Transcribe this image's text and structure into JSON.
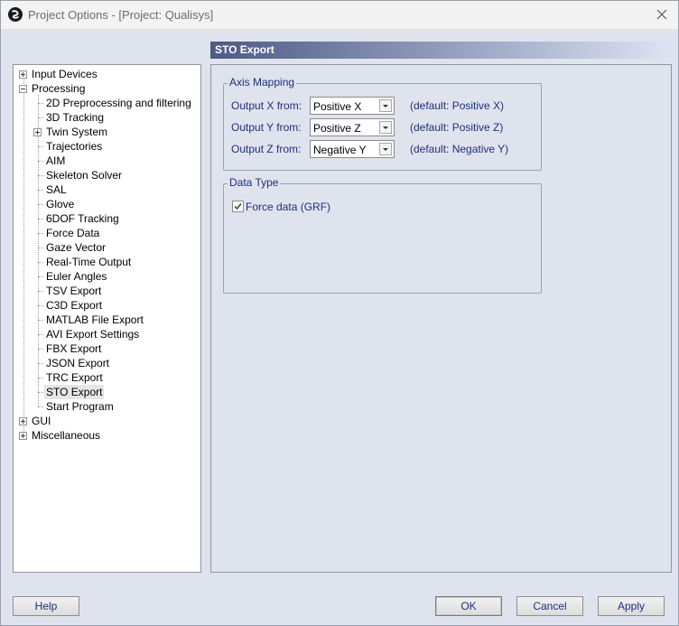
{
  "window": {
    "title": "Project Options - [Project: Qualisys]"
  },
  "tree": {
    "items": [
      {
        "label": "Input Devices",
        "expandable": true,
        "expanded": false,
        "level": 0
      },
      {
        "label": "Processing",
        "expandable": true,
        "expanded": true,
        "level": 0
      },
      {
        "label": "2D Preprocessing and filtering",
        "level": 1
      },
      {
        "label": "3D Tracking",
        "level": 1
      },
      {
        "label": "Twin System",
        "expandable": true,
        "expanded": false,
        "level": 1
      },
      {
        "label": "Trajectories",
        "level": 1
      },
      {
        "label": "AIM",
        "level": 1
      },
      {
        "label": "Skeleton Solver",
        "level": 1
      },
      {
        "label": "SAL",
        "level": 1
      },
      {
        "label": "Glove",
        "level": 1
      },
      {
        "label": "6DOF Tracking",
        "level": 1
      },
      {
        "label": "Force Data",
        "level": 1
      },
      {
        "label": "Gaze Vector",
        "level": 1
      },
      {
        "label": "Real-Time Output",
        "level": 1
      },
      {
        "label": "Euler Angles",
        "level": 1
      },
      {
        "label": "TSV Export",
        "level": 1
      },
      {
        "label": "C3D Export",
        "level": 1
      },
      {
        "label": "MATLAB File Export",
        "level": 1
      },
      {
        "label": "AVI Export Settings",
        "level": 1
      },
      {
        "label": "FBX Export",
        "level": 1
      },
      {
        "label": "JSON Export",
        "level": 1
      },
      {
        "label": "TRC Export",
        "level": 1
      },
      {
        "label": "STO Export",
        "level": 1,
        "selected": true
      },
      {
        "label": "Start Program",
        "level": 1
      },
      {
        "label": "GUI",
        "expandable": true,
        "expanded": false,
        "level": 0
      },
      {
        "label": "Miscellaneous",
        "expandable": true,
        "expanded": false,
        "level": 0
      }
    ]
  },
  "pane": {
    "title": "STO Export",
    "axis_mapping": {
      "title": "Axis Mapping",
      "rows": [
        {
          "label": "Output X from:",
          "value": "Positive X",
          "default": "(default: Positive X)"
        },
        {
          "label": "Output Y from:",
          "value": "Positive Z",
          "default": "(default: Positive Z)"
        },
        {
          "label": "Output Z from:",
          "value": "Negative Y",
          "default": "(default: Negative Y)"
        }
      ]
    },
    "data_type": {
      "title": "Data Type",
      "force_data_label": "Force data (GRF)",
      "force_data_checked": true
    }
  },
  "buttons": {
    "help": "Help",
    "ok": "OK",
    "cancel": "Cancel",
    "apply": "Apply"
  },
  "colors": {
    "label_text": "#1f2f78",
    "header_dark": "#4e5a84",
    "window_bg": "#dfe3ee"
  }
}
